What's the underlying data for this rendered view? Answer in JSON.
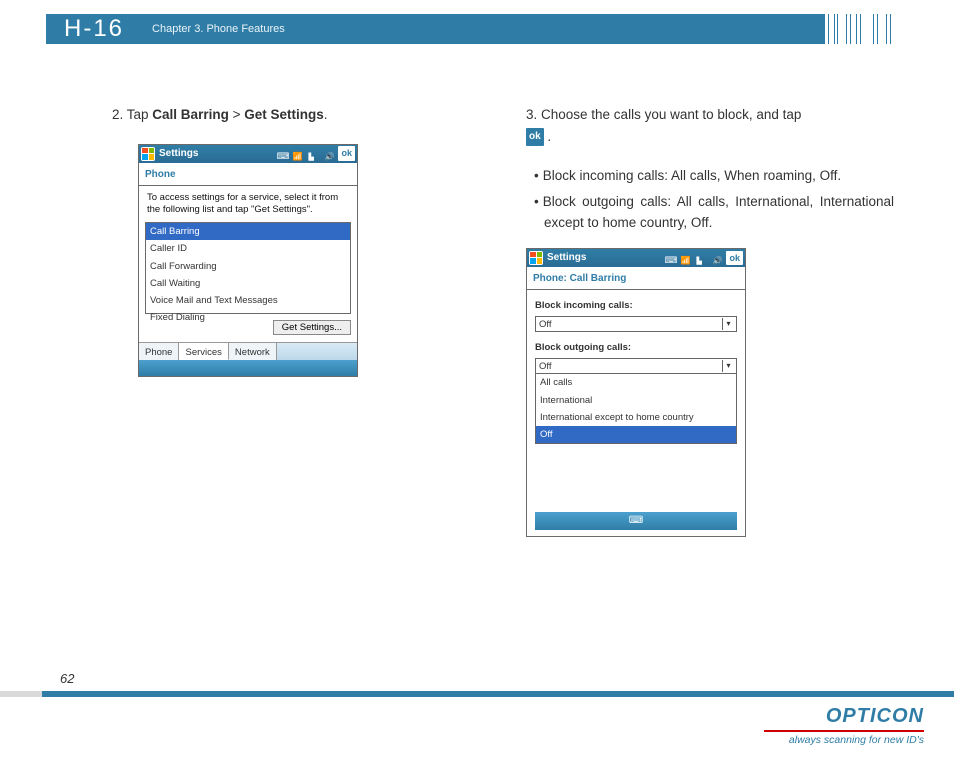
{
  "header": {
    "model": "H-16",
    "chapter": "Chapter 3. Phone Features"
  },
  "left": {
    "step_prefix": "2. Tap ",
    "step_b1": "Call Barring",
    "step_sep": " > ",
    "step_b2": "Get Settings",
    "step_suffix": "."
  },
  "device1": {
    "title": "Settings",
    "ok": "ok",
    "sub": "Phone",
    "hint": "To access settings for a service, select it from the following list and tap \"Get Settings\".",
    "items": [
      "Call Barring",
      "Caller ID",
      "Call Forwarding",
      "Call Waiting",
      "Voice Mail and Text Messages",
      "Fixed Dialing"
    ],
    "button": "Get Settings...",
    "tabs": [
      "Phone",
      "Services",
      "Network"
    ]
  },
  "right": {
    "step": "3. Choose the calls you want to block, and tap ",
    "ok": "ok",
    "period": " .",
    "bullet1": "Block incoming calls: All calls, When roaming, Off.",
    "bullet2": "Block outgoing calls: All calls, International, International except to home country, Off."
  },
  "device2": {
    "title": "Settings",
    "ok": "ok",
    "sub": "Phone: Call Barring",
    "label_in": "Block incoming calls:",
    "value_in": "Off",
    "label_out": "Block outgoing calls:",
    "value_out": "Off",
    "options_out": [
      "All calls",
      "International",
      "International except to home country",
      "Off"
    ]
  },
  "footer": {
    "page": "62",
    "brand": "OPTICON",
    "tagline": "always scanning for new ID's"
  }
}
